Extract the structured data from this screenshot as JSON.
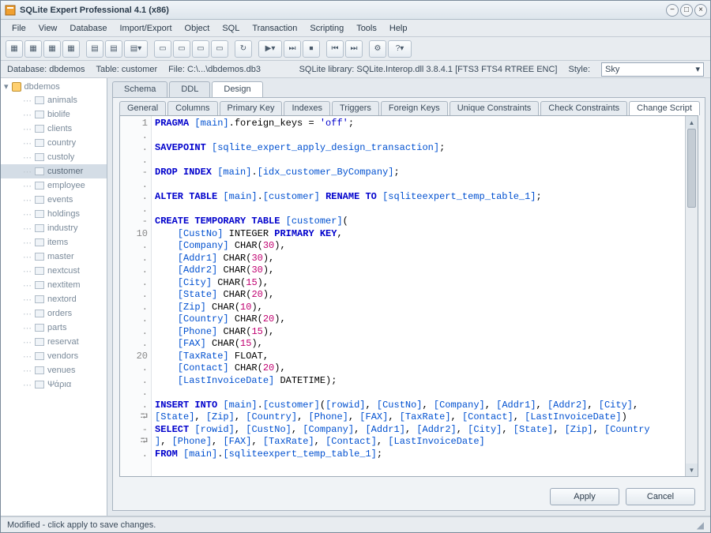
{
  "window": {
    "title": "SQLite Expert Professional 4.1 (x86)"
  },
  "menu": [
    "File",
    "View",
    "Database",
    "Import/Export",
    "Object",
    "SQL",
    "Transaction",
    "Scripting",
    "Tools",
    "Help"
  ],
  "info": {
    "db_label": "Database:",
    "db_val": "dbdemos",
    "table_label": "Table:",
    "table_val": "customer",
    "file_label": "File:",
    "file_val": "C:\\...\\dbdemos.db3",
    "lib_label": "SQLite library:",
    "lib_val": "SQLite.Interop.dll 3.8.4.1 [FTS3 FTS4 RTREE ENC]",
    "style_label": "Style:",
    "style_val": "Sky"
  },
  "tree": {
    "root": "dbdemos",
    "items": [
      "animals",
      "biolife",
      "clients",
      "country",
      "custoly",
      "customer",
      "employee",
      "events",
      "holdings",
      "industry",
      "items",
      "master",
      "nextcust",
      "nextitem",
      "nextord",
      "orders",
      "parts",
      "reservat",
      "vendors",
      "venues",
      "Ψάρια"
    ],
    "selected": "customer"
  },
  "tabs_top": [
    "Schema",
    "DDL",
    "Design"
  ],
  "tabs_top_active": "Design",
  "tabs_sub": [
    "General",
    "Columns",
    "Primary Key",
    "Indexes",
    "Triggers",
    "Foreign Keys",
    "Unique Constraints",
    "Check Constraints",
    "Change Script"
  ],
  "tabs_sub_active": "Change Script",
  "gutter": "1\n.\n.\n.\n-\n.\n.\n.\n-\n10\n.\n.\n.\n.\n.\n.\n.\n.\n.\n20\n.\n.\n.\n.\n⮒\n-\n⮒\n.",
  "buttons": {
    "apply": "Apply",
    "cancel": "Cancel"
  },
  "status": "Modified - click apply to save changes."
}
